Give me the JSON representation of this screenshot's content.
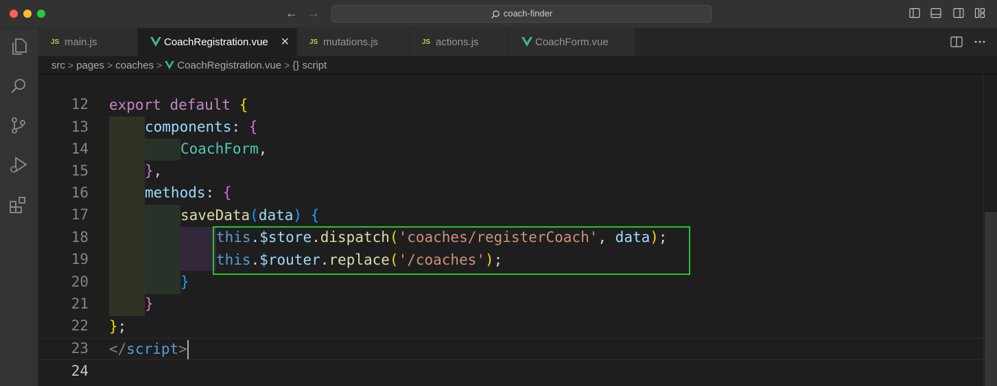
{
  "window": {
    "search_text": "coach-finder",
    "nav_back": "←",
    "nav_forward": "→"
  },
  "activity_bar": {
    "items": [
      "explorer-icon",
      "search-icon",
      "source-control-icon",
      "run-debug-icon",
      "extensions-icon"
    ]
  },
  "tabs": [
    {
      "icon": "JS",
      "label": "main.js",
      "active": false
    },
    {
      "icon": "vue",
      "label": "CoachRegistration.vue",
      "active": true,
      "close": "✕"
    },
    {
      "icon": "JS",
      "label": "mutations.js",
      "active": false
    },
    {
      "icon": "JS",
      "label": "actions.js",
      "active": false
    },
    {
      "icon": "vue",
      "label": "CoachForm.vue",
      "active": false
    }
  ],
  "breadcrumb": {
    "parts": [
      "src",
      "pages",
      "coaches",
      "CoachRegistration.vue",
      "{} script"
    ],
    "separator": ">"
  },
  "editor": {
    "current_line": 24,
    "lines": [
      {
        "n": "12"
      },
      {
        "n": "13",
        "t": [
          "export",
          " ",
          "default",
          " ",
          "{"
        ]
      },
      {
        "n": "14",
        "t": [
          "components",
          ":",
          " ",
          "{"
        ]
      },
      {
        "n": "15",
        "t": [
          "CoachForm",
          ","
        ]
      },
      {
        "n": "16",
        "t": [
          "}",
          ","
        ]
      },
      {
        "n": "17",
        "t": [
          "methods",
          ":",
          " ",
          "{"
        ]
      },
      {
        "n": "18",
        "t": [
          "saveData",
          "(",
          "data",
          ")",
          " ",
          "{"
        ]
      },
      {
        "n": "19",
        "t": [
          "this",
          ".",
          "$store",
          ".",
          "dispatch",
          "(",
          "'coaches/registerCoach'",
          ",",
          " ",
          "data",
          ")",
          ";"
        ]
      },
      {
        "n": "20",
        "t": [
          "this",
          ".",
          "$router",
          ".",
          "replace",
          "(",
          "'/coaches'",
          ")",
          ";"
        ]
      },
      {
        "n": "21",
        "t": [
          "}"
        ]
      },
      {
        "n": "22",
        "t": [
          "}"
        ]
      },
      {
        "n": "23",
        "t": [
          "}",
          ";"
        ]
      },
      {
        "n": "24",
        "t": [
          "</",
          "script",
          ">"
        ]
      }
    ]
  },
  "colors": {
    "highlight_box": "#2ac52e",
    "keyword": "#c586c0",
    "string": "#ce9178",
    "property": "#9cdcfe",
    "class": "#4ec9b0",
    "function": "#dcdcaa"
  }
}
